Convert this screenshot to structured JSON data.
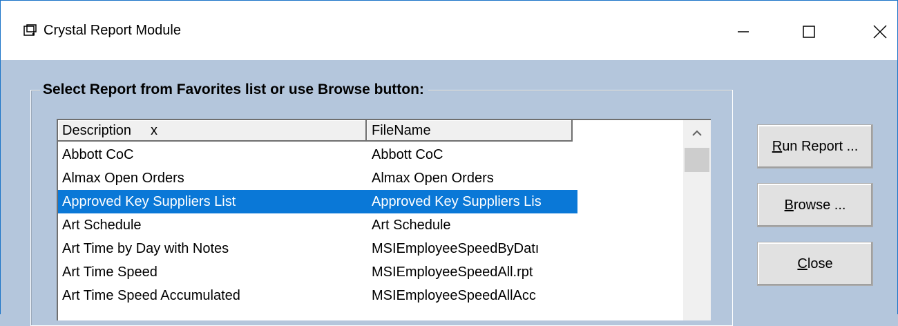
{
  "window": {
    "title": "Crystal Report Module",
    "controls": [
      "minimize",
      "maximize",
      "close"
    ]
  },
  "group": {
    "legend": "Select Report from Favorites list or use Browse button:"
  },
  "list": {
    "columns": [
      {
        "label": "Description",
        "sort_marker": "x"
      },
      {
        "label": "FileName"
      }
    ],
    "rows": [
      {
        "description": "Abbott CoC",
        "filename": "Abbott CoC",
        "selected": false
      },
      {
        "description": "Almax Open Orders",
        "filename": "Almax Open Orders",
        "selected": false
      },
      {
        "description": "Approved Key Suppliers List",
        "filename": "Approved Key Suppliers Lis",
        "selected": true
      },
      {
        "description": "Art Schedule",
        "filename": "Art Schedule",
        "selected": false
      },
      {
        "description": "Art Time by Day with Notes",
        "filename": "MSIEmployeeSpeedByDatı",
        "selected": false
      },
      {
        "description": "Art Time Speed",
        "filename": "MSIEmployeeSpeedAll.rpt",
        "selected": false
      },
      {
        "description": "Art Time Speed Accumulated",
        "filename": "MSIEmployeeSpeedAllAcc",
        "selected": false
      }
    ]
  },
  "buttons": {
    "run": {
      "accel": "R",
      "rest": "un Report ..."
    },
    "browse": {
      "accel": "B",
      "rest": "rowse ..."
    },
    "close": {
      "accel": "C",
      "rest": "lose"
    }
  },
  "colors": {
    "background": "#b4c6dc",
    "selection": "#0a78d7"
  }
}
